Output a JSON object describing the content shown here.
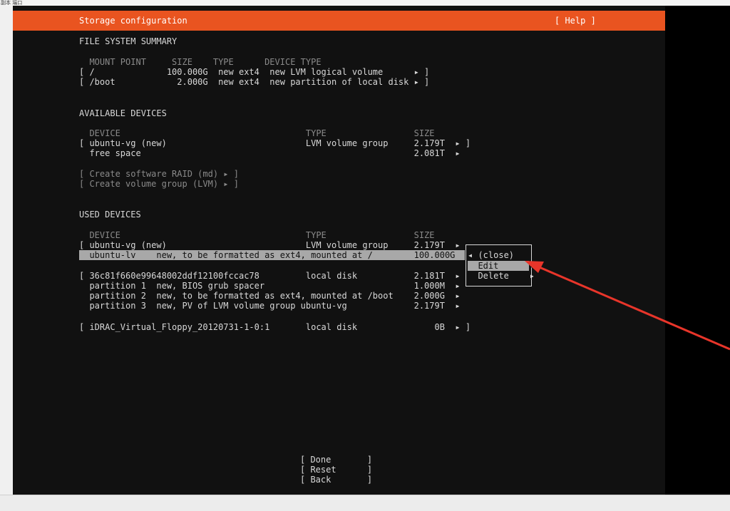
{
  "window": {
    "topstrip_text": "副本 端口"
  },
  "header": {
    "title": "Storage configuration",
    "help": "[ Help ]"
  },
  "fs_summary": {
    "heading": "FILE SYSTEM SUMMARY",
    "columns": "  MOUNT POINT     SIZE    TYPE      DEVICE TYPE",
    "rows": [
      "[ /              100.000G  new ext4  new LVM logical volume      ▸ ]",
      "[ /boot            2.000G  new ext4  new partition of local disk ▸ ]"
    ]
  },
  "available": {
    "heading": "AVAILABLE DEVICES",
    "columns": "  DEVICE                                    TYPE                 SIZE",
    "rows": [
      "[ ubuntu-vg (new)                           LVM volume group     2.179T  ▸ ]",
      "  free space                                                     2.081T  ▸"
    ],
    "actions": [
      "[ Create software RAID (md) ▸ ]",
      "[ Create volume group (LVM) ▸ ]"
    ]
  },
  "used": {
    "heading": "USED DEVICES",
    "columns": "  DEVICE                                    TYPE                 SIZE",
    "rows": [
      "[ ubuntu-vg (new)                           LVM volume group     2.179T  ▸",
      "  ubuntu-lv    new, to be formatted as ext4, mounted at /        100.000G  ▸",
      "[ 36c81f660e99648002ddf12100fccac78         local disk           2.181T  ▸",
      "  partition 1  new, BIOS grub spacer                             1.000M  ▸",
      "  partition 2  new, to be formatted as ext4, mounted at /boot    2.000G  ▸",
      "  partition 3  new, PV of LVM volume group ubuntu-vg             2.179T  ▸",
      "[ iDRAC_Virtual_Floppy_20120731-1-0:1       local disk               0B  ▸ ]"
    ]
  },
  "popup": {
    "close": "◂ (close)",
    "edit": "  Edit      ▸",
    "delete": "  Delete    ▸"
  },
  "buttons": {
    "done": "[ Done       ]",
    "reset": "[ Reset      ]",
    "back": "[ Back       ]"
  },
  "colors": {
    "accent": "#e95420",
    "highlight": "#a8a8a8",
    "arrow": "#e8352a"
  }
}
